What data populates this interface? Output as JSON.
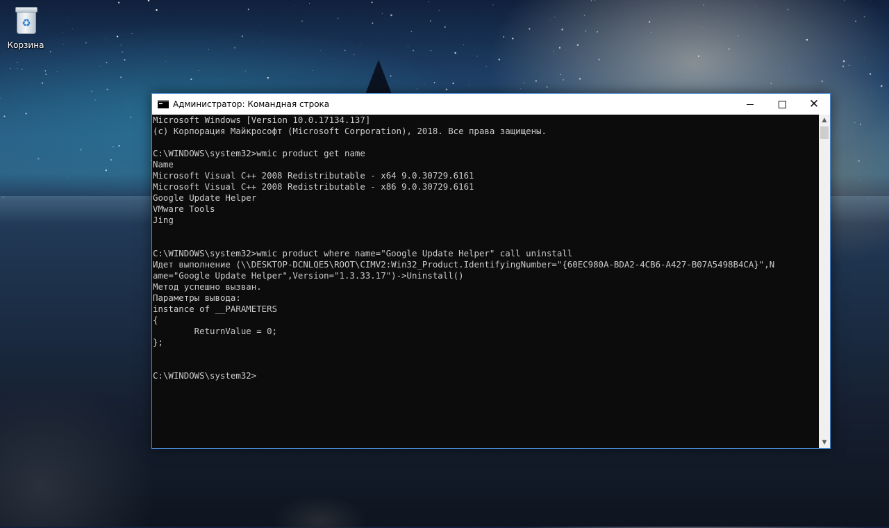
{
  "desktop": {
    "icons": [
      {
        "label": "Корзина",
        "icon": "recycle-bin-icon"
      }
    ]
  },
  "window": {
    "title": "Администратор: Командная строка",
    "icon": "cmd-icon",
    "controls": {
      "minimize": "minimize-icon",
      "maximize": "maximize-icon",
      "close": "✕"
    }
  },
  "console": {
    "lines": [
      "Microsoft Windows [Version 10.0.17134.137]",
      "(c) Корпорация Майкрософт (Microsoft Corporation), 2018. Все права защищены.",
      "",
      "C:\\WINDOWS\\system32>wmic product get name",
      "Name",
      "Microsoft Visual C++ 2008 Redistributable - x64 9.0.30729.6161",
      "Microsoft Visual C++ 2008 Redistributable - x86 9.0.30729.6161",
      "Google Update Helper",
      "VMware Tools",
      "Jing",
      "",
      "",
      "C:\\WINDOWS\\system32>wmic product where name=\"Google Update Helper\" call uninstall",
      "Идет выполнение (\\\\DESKTOP-DCNLQE5\\ROOT\\CIMV2:Win32_Product.IdentifyingNumber=\"{60EC980A-BDA2-4CB6-A427-B07A5498B4CA}\",N",
      "ame=\"Google Update Helper\",Version=\"1.3.33.17\")->Uninstall()",
      "Метод успешно вызван.",
      "Параметры вывода:",
      "instance of __PARAMETERS",
      "{",
      "        ReturnValue = 0;",
      "};",
      "",
      "",
      "C:\\WINDOWS\\system32>"
    ]
  },
  "colors": {
    "console_bg": "#0c0c0c",
    "console_fg": "#cccccc",
    "window_border": "#4a8ad6"
  }
}
